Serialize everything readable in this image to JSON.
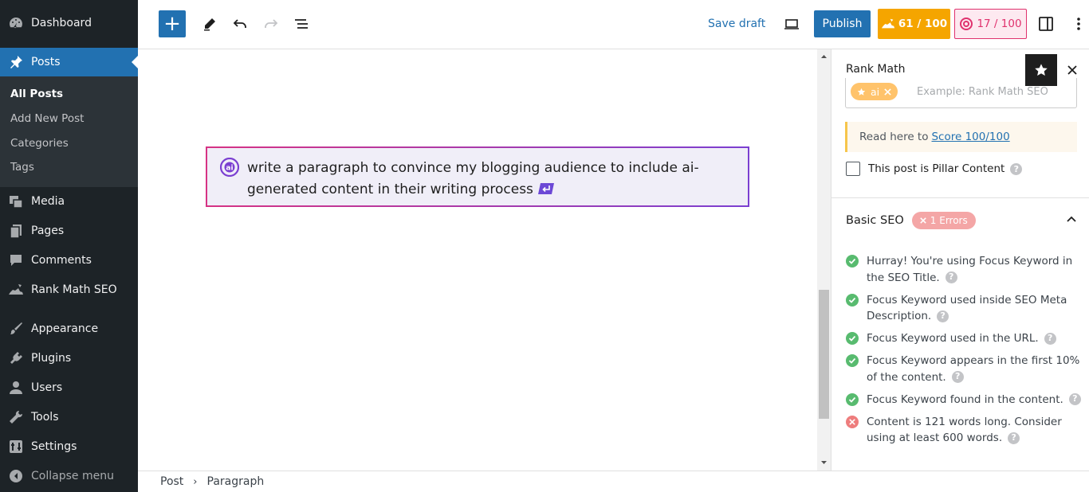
{
  "sidebar": {
    "items": [
      {
        "label": "Dashboard",
        "icon": "dashboard-icon"
      },
      {
        "label": "Posts",
        "icon": "pin-icon"
      },
      {
        "label": "Media",
        "icon": "media-icon"
      },
      {
        "label": "Pages",
        "icon": "pages-icon"
      },
      {
        "label": "Comments",
        "icon": "comment-icon"
      },
      {
        "label": "Rank Math SEO",
        "icon": "rank-math-icon"
      },
      {
        "label": "Appearance",
        "icon": "paintbrush-icon"
      },
      {
        "label": "Plugins",
        "icon": "plug-icon"
      },
      {
        "label": "Users",
        "icon": "user-icon"
      },
      {
        "label": "Tools",
        "icon": "wrench-icon"
      },
      {
        "label": "Settings",
        "icon": "settings-icon"
      }
    ],
    "submenu": [
      "All Posts",
      "Add New Post",
      "Categories",
      "Tags"
    ],
    "collapse": "Collapse menu"
  },
  "toolbar": {
    "save_draft": "Save draft",
    "publish": "Publish",
    "score_seo": "61 / 100",
    "score_content": "17 / 100"
  },
  "editor": {
    "ai_prompt": "write a paragraph to convince my blogging audience to include ai-generated content in their writing process"
  },
  "panel": {
    "title": "Rank Math",
    "keyword_tag": "ai",
    "keyword_placeholder": "Example: Rank Math SEO",
    "notice_prefix": "Read here to",
    "notice_link": "Score 100/100",
    "pillar_label": "This post is Pillar Content",
    "basic_seo": "Basic SEO",
    "errors_badge": "1 Errors",
    "checks": [
      {
        "text": "Hurray! You're using Focus Keyword in the SEO Title.",
        "ok": true
      },
      {
        "text": "Focus Keyword used inside SEO Meta Description.",
        "ok": true
      },
      {
        "text": "Focus Keyword used in the URL.",
        "ok": true
      },
      {
        "text": "Focus Keyword appears in the first 10% of the content.",
        "ok": true
      },
      {
        "text": "Focus Keyword found in the content.",
        "ok": true
      },
      {
        "text": "Content is 121 words long. Consider using at least 600 words.",
        "ok": false
      }
    ]
  },
  "breadcrumb": [
    "Post",
    "Paragraph"
  ],
  "colors": {
    "accent": "#2271b1",
    "sidebar": "#1d2327",
    "seo_score": "#f5a500",
    "content_score": "#e0326e"
  }
}
